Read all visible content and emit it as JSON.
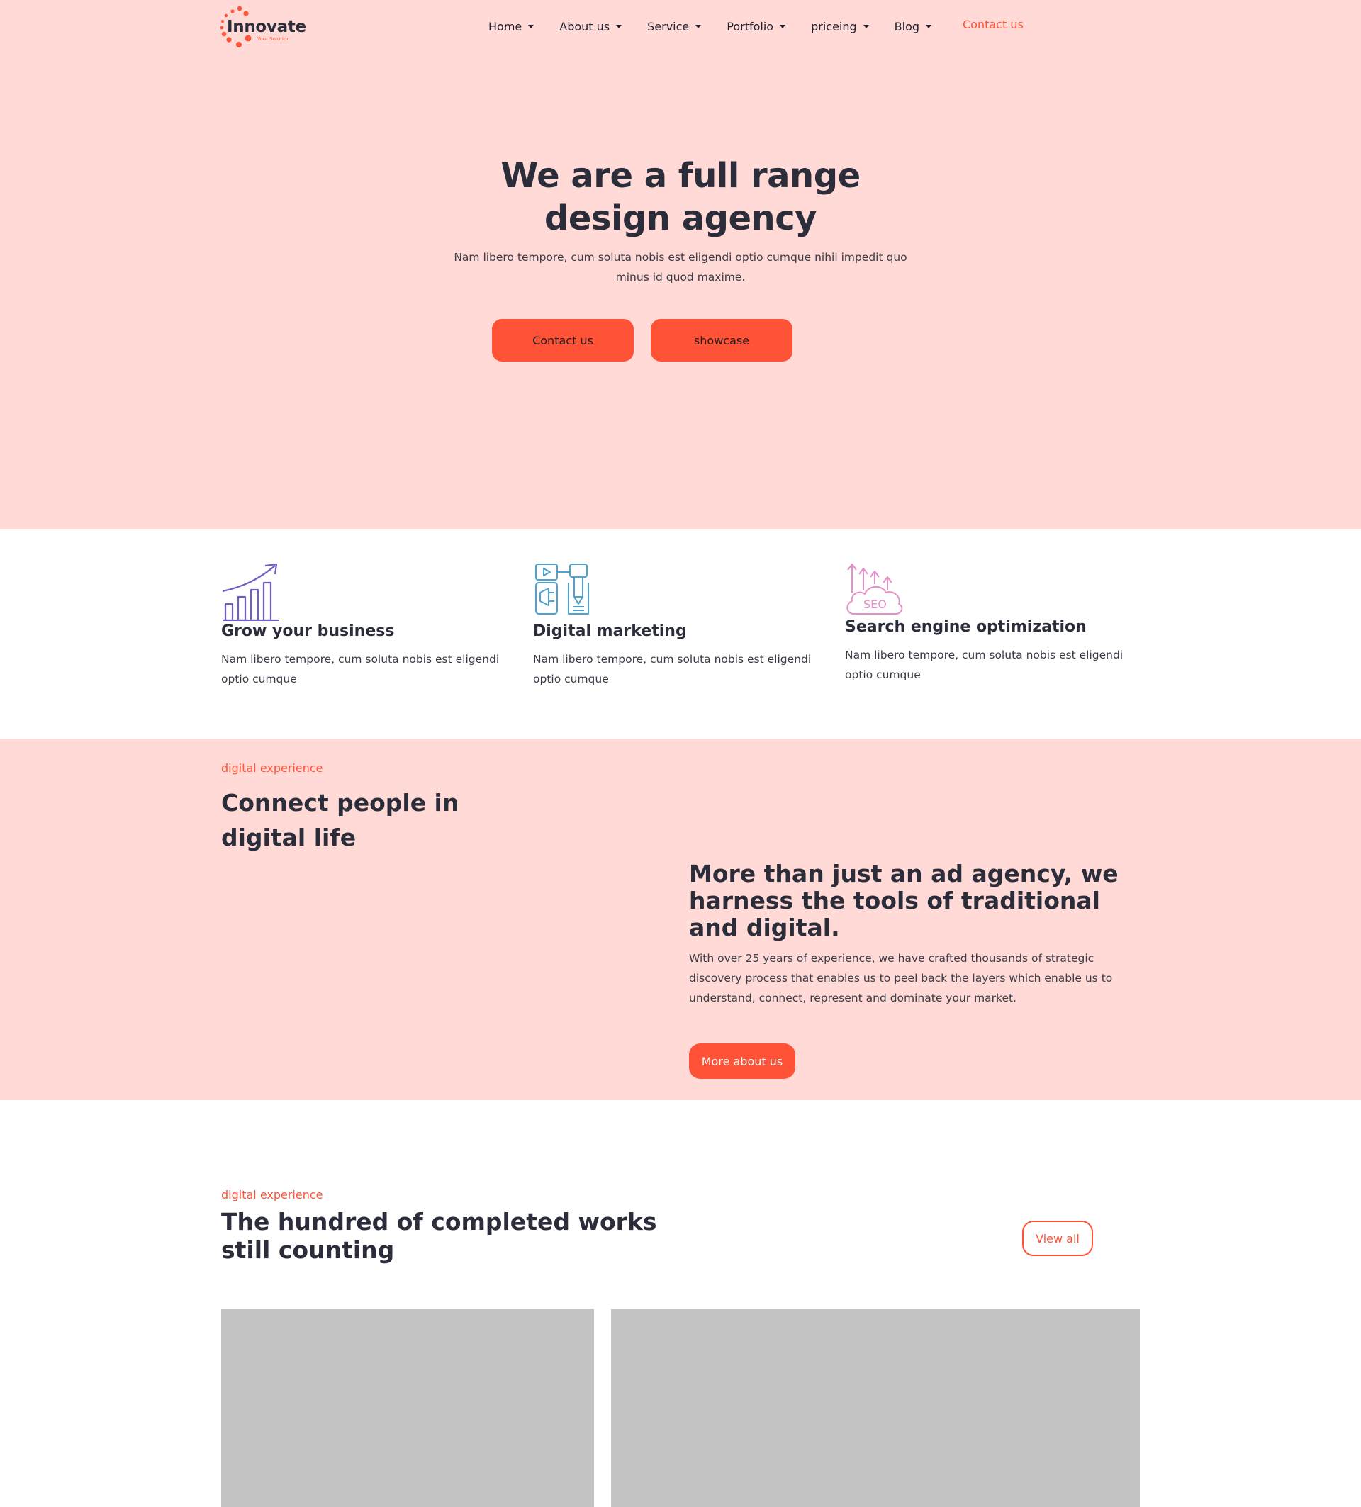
{
  "brand": {
    "name": "Innovate",
    "tagline": "Your Solution",
    "accent": "#ff5236",
    "bg_pink": "#ffdad6"
  },
  "nav": {
    "items": [
      {
        "label": "Home"
      },
      {
        "label": "About us"
      },
      {
        "label": "Service"
      },
      {
        "label": "Portfolio"
      },
      {
        "label": "priceing"
      },
      {
        "label": "Blog"
      }
    ],
    "contact_label": "Contact us"
  },
  "hero": {
    "title_line1": "We are a full range",
    "title_line2": "design agency",
    "subtitle": "Nam libero tempore, cum soluta nobis est eligendi optio cumque nihil impedit quo minus id quod maxime.",
    "primary_button": "Contact us",
    "secondary_button": "showcase"
  },
  "features": [
    {
      "icon": "growth-chart-icon",
      "title": "Grow your business",
      "text": "Nam libero tempore, cum soluta nobis est eligendi optio cumque"
    },
    {
      "icon": "digital-marketing-icon",
      "title": "Digital marketing",
      "text": "Nam libero tempore, cum soluta nobis est eligendi optio cumque"
    },
    {
      "icon": "seo-cloud-icon",
      "title": "Search engine optimization",
      "text": "Nam libero tempore, cum soluta nobis est eligendi optio cumque"
    }
  ],
  "about": {
    "eyebrow": "digital experience",
    "heading": "Connect people in digital life",
    "subheading": "More than just an ad agency, we harness the tools of traditional and digital.",
    "body": "With over 25 years of experience, we have crafted thousands of strategic discovery process that enables us to peel back the layers which enable us to understand, connect, represent and dominate your market.",
    "button": "More about us"
  },
  "works": {
    "eyebrow": "digital experience",
    "heading": "The hundred of completed works still counting",
    "button": "View all"
  }
}
